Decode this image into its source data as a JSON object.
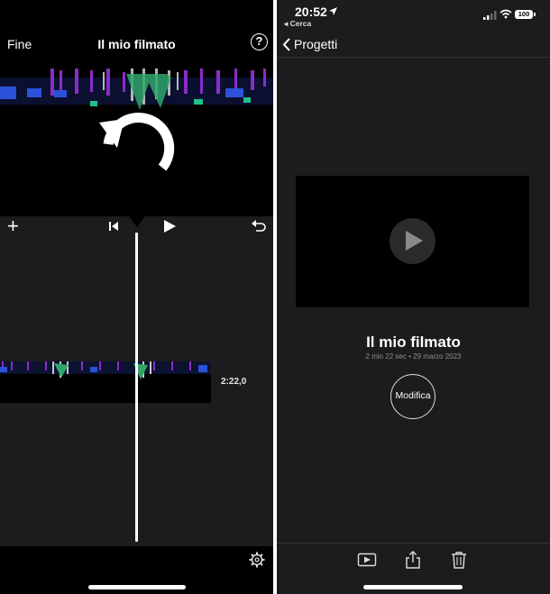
{
  "left": {
    "header": {
      "done_label": "Fine",
      "title": "Il mio filmato",
      "help_glyph": "?"
    },
    "controls": {
      "add_glyph": "+"
    },
    "timeline": {
      "clip_duration": "2:22,0"
    }
  },
  "right": {
    "status_bar": {
      "time": "20:52",
      "back_app": "◂ Cerca",
      "battery": "100"
    },
    "nav": {
      "back_label": "Progetti"
    },
    "project": {
      "title": "Il mio filmato",
      "meta": "2 min 22 sec • 29 marzo 2023",
      "edit_label": "Modifica"
    }
  },
  "icons": [
    "help-icon",
    "undo-icon",
    "add-icon",
    "skip-to-start-icon",
    "play-icon",
    "gear-icon",
    "location-arrow-icon",
    "signal-icon",
    "wifi-icon",
    "battery-icon",
    "chevron-left-icon",
    "play-preview-icon",
    "share-icon",
    "trash-icon"
  ],
  "colors": {
    "background": "#1c1c1e",
    "video_bg": "#000000",
    "text": "#ffffff",
    "secondary_text": "#8e8e93"
  }
}
